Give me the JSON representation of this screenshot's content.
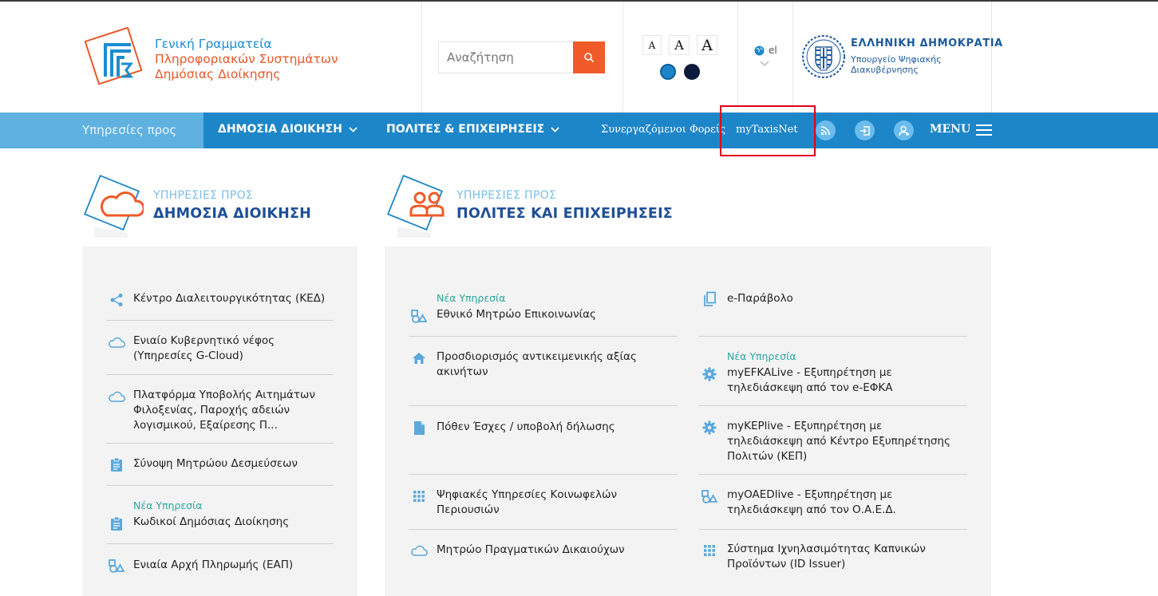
{
  "header": {
    "logo_lines": [
      "Γενική Γραμματεία",
      "Πληροφοριακών Συστημάτων",
      "Δημόσιας Διοίκησης"
    ],
    "search": {
      "placeholder": "Αναζήτηση",
      "button_icon": "search-icon"
    },
    "font_sizes": [
      "A",
      "A",
      "A"
    ],
    "contrast_colors": [
      "#1d86c8",
      "#0d1a3a"
    ],
    "language": "el",
    "republic": {
      "title": "ΕΛΛΗΝΙΚΗ ΔΗΜΟΚΡΑΤΙΑ",
      "subtitle_lines": [
        "Υπουργείο Ψηφιακής",
        "Διακυβέρνησης"
      ]
    }
  },
  "nav": {
    "prefix": "Υπηρεσίες προς",
    "items": [
      "ΔΗΜΟΣΙΑ ΔΙΟΙΚΗΣΗ",
      "ΠΟΛΙΤΕΣ & ΕΠΙΧΕΙΡΗΣΕΙΣ"
    ],
    "links": [
      "Συνεργαζόμενοι Φορείς",
      "myTaxisNet"
    ],
    "icons": [
      "rss-icon",
      "login-icon",
      "user-add-icon"
    ],
    "menu_label": "MENU"
  },
  "sections": {
    "public_admin": {
      "kicker": "ΥΠΗΡΕΣΙΕΣ ΠΡΟΣ",
      "title": "ΔΗΜΟΣΙΑ ΔΙΟΙΚΗΣΗ",
      "items": [
        {
          "icon": "share-icon",
          "lines": [
            "Κέντρο Διαλειτουργικότητας (ΚΕΔ)"
          ]
        },
        {
          "icon": "cloud-icon",
          "lines": [
            "Ενιαίο Κυβερνητικό νέφος",
            "(Υπηρεσίες G-Cloud)"
          ]
        },
        {
          "icon": "cloud-icon",
          "lines": [
            "Πλατφόρμα Υποβολής Αιτημάτων",
            "Φιλοξενίας, Παροχής αδειών",
            "λογισμικού, Εξαίρεσης Π..."
          ]
        },
        {
          "icon": "clipboard-icon",
          "lines": [
            "Σύνοψη Μητρώου Δεσμεύσεων"
          ]
        },
        {
          "icon": "clipboard-icon",
          "badge": "Νέα Υπηρεσία",
          "lines": [
            "Κωδικοί Δημόσιας Διοίκησης"
          ]
        },
        {
          "icon": "shapes-icon",
          "lines": [
            "Ενιαία Αρχή Πληρωμής (ΕΑΠ)"
          ]
        }
      ]
    },
    "citizens": {
      "kicker": "ΥΠΗΡΕΣΙΕΣ ΠΡΟΣ",
      "title": "ΠΟΛΙΤΕΣ ΚΑΙ ΕΠΙΧΕΙΡΗΣΕΙΣ",
      "left_items": [
        {
          "icon": "shapes-icon",
          "badge": "Νέα Υπηρεσία",
          "lines": [
            "Εθνικό Μητρώο Επικοινωνίας"
          ]
        },
        {
          "icon": "home-icon",
          "lines": [
            "Προσδιορισμός αντικειμενικής αξίας",
            "ακινήτων"
          ]
        },
        {
          "icon": "document-icon",
          "lines": [
            "Πόθεν Έσχες / υποβολή δήλωσης"
          ]
        },
        {
          "icon": "grid-icon",
          "lines": [
            "Ψηφιακές Υπηρεσίες Κοινωφελών",
            "Περιουσιών"
          ]
        },
        {
          "icon": "cloud-icon",
          "lines": [
            "Μητρώο Πραγματικών Δικαιούχων"
          ]
        }
      ],
      "right_items": [
        {
          "icon": "copy-icon",
          "lines": [
            "e-Παράβολο"
          ]
        },
        {
          "icon": "gear-icon",
          "badge": "Νέα Υπηρεσία",
          "lines": [
            "myEFKALive - Εξυπηρέτηση με",
            "τηλεδιάσκεψη από τον e-ΕΦΚΑ"
          ]
        },
        {
          "icon": "gear-icon",
          "lines": [
            "myKEPlive - Εξυπηρέτηση με",
            "τηλεδιάσκεψη από Κέντρο Εξυπηρέτησης",
            "Πολιτών (ΚΕΠ)"
          ]
        },
        {
          "icon": "shapes-icon",
          "lines": [
            "myOAEDlive - Εξυπηρέτηση με",
            "τηλεδιάσκεψη από τον Ο.Α.Ε.Δ."
          ]
        },
        {
          "icon": "grid-icon",
          "lines": [
            "Σύστημα Ιχνηλασιμότητας Καπνικών",
            "Προϊόντων (ID Issuer)"
          ]
        }
      ]
    }
  },
  "colors": {
    "accent": "#f15a29",
    "nav": "#1d86c8",
    "nav_light": "#5fb1e0",
    "title": "#1f4f97",
    "icon": "#5aa8dc",
    "new_badge": "#2aa5a0",
    "highlight": "#e1001a"
  }
}
